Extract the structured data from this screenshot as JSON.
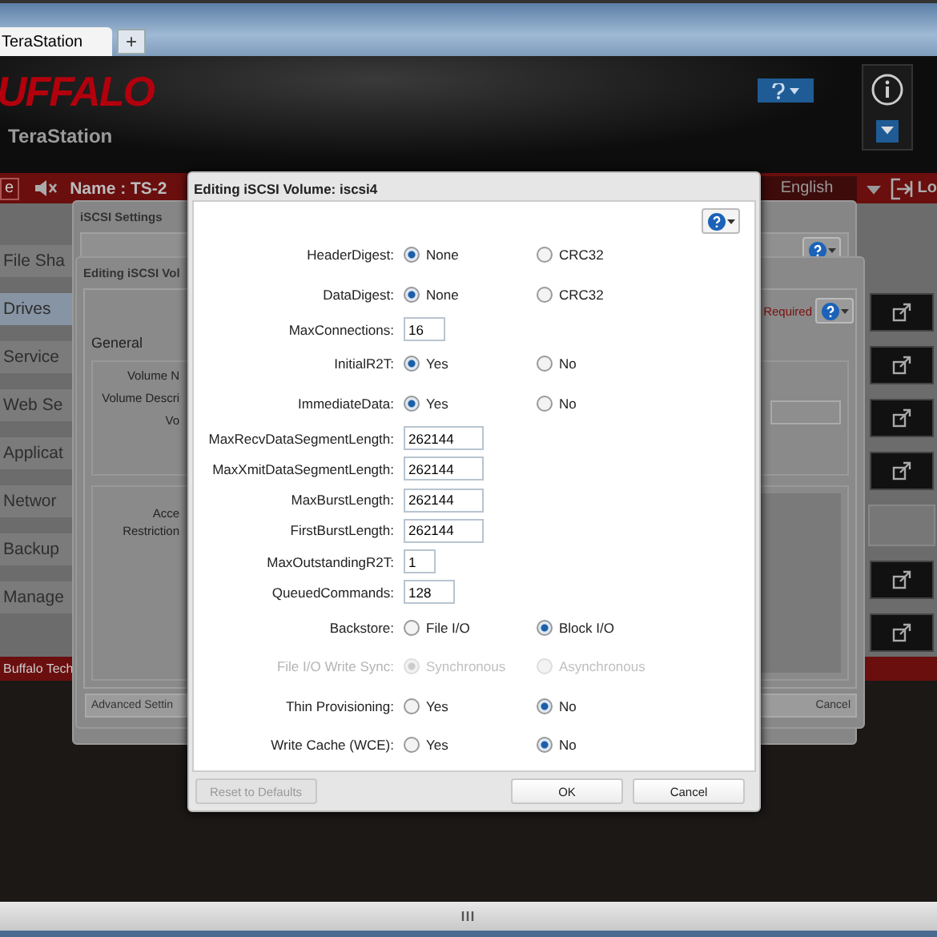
{
  "browser": {
    "tab": {
      "title": "TeraStation"
    },
    "new_tab_button": "+"
  },
  "header": {
    "logo": "UFFALO",
    "product": "TeraStation"
  },
  "top_bar": {
    "button_fragment": "e",
    "name": "Name : TS-2",
    "language": "English",
    "logout_fragment": "Lo"
  },
  "sidebar": {
    "items": [
      {
        "label": "File Sha",
        "selected": false
      },
      {
        "label": "Drives",
        "selected": true
      },
      {
        "label": "Service",
        "selected": false
      },
      {
        "label": "Web Se",
        "selected": false
      },
      {
        "label": "Applicat",
        "selected": false
      },
      {
        "label": "Networ",
        "selected": false
      },
      {
        "label": "Backup",
        "selected": false
      },
      {
        "label": "Manage",
        "selected": false
      }
    ]
  },
  "footer": {
    "text": "Buffalo Tech"
  },
  "settings_dialog": {
    "title": "iSCSI Settings"
  },
  "volume_dialog": {
    "title": "Editing iSCSI Vol",
    "required": "Required",
    "section": "General",
    "labels": [
      "Volume N",
      "Volume Descri",
      "Vo"
    ],
    "access_labels": [
      "Acce",
      "Restriction"
    ],
    "buttons": [
      "Advanced Settin",
      "Cancel"
    ]
  },
  "modal": {
    "title": "Editing iSCSI Volume: iscsi4",
    "rows": [
      {
        "kind": "radio",
        "label": "HeaderDigest:",
        "disabled": false,
        "options": [
          {
            "label": "None",
            "selected": true
          },
          {
            "label": "CRC32",
            "selected": false
          }
        ]
      },
      {
        "kind": "radio",
        "label": "DataDigest:",
        "disabled": false,
        "options": [
          {
            "label": "None",
            "selected": true
          },
          {
            "label": "CRC32",
            "selected": false
          }
        ]
      },
      {
        "kind": "input",
        "label": "MaxConnections:",
        "value": "16"
      },
      {
        "kind": "radio",
        "label": "InitialR2T:",
        "disabled": false,
        "options": [
          {
            "label": "Yes",
            "selected": true
          },
          {
            "label": "No",
            "selected": false
          }
        ]
      },
      {
        "kind": "radio",
        "label": "ImmediateData:",
        "disabled": false,
        "options": [
          {
            "label": "Yes",
            "selected": true
          },
          {
            "label": "No",
            "selected": false
          }
        ]
      },
      {
        "kind": "input",
        "label": "MaxRecvDataSegmentLength:",
        "value": "262144"
      },
      {
        "kind": "input",
        "label": "MaxXmitDataSegmentLength:",
        "value": "262144"
      },
      {
        "kind": "input",
        "label": "MaxBurstLength:",
        "value": "262144"
      },
      {
        "kind": "input",
        "label": "FirstBurstLength:",
        "value": "262144"
      },
      {
        "kind": "input",
        "label": "MaxOutstandingR2T:",
        "value": "1"
      },
      {
        "kind": "input",
        "label": "QueuedCommands:",
        "value": "128"
      },
      {
        "kind": "radio",
        "label": "Backstore:",
        "disabled": false,
        "options": [
          {
            "label": "File I/O",
            "selected": false
          },
          {
            "label": "Block I/O",
            "selected": true
          }
        ]
      },
      {
        "kind": "radio",
        "label": "File I/O Write Sync:",
        "disabled": true,
        "options": [
          {
            "label": "Synchronous",
            "selected": true
          },
          {
            "label": "Asynchronous",
            "selected": false
          }
        ]
      },
      {
        "kind": "radio",
        "label": "Thin Provisioning:",
        "disabled": false,
        "options": [
          {
            "label": "Yes",
            "selected": false
          },
          {
            "label": "No",
            "selected": true
          }
        ]
      },
      {
        "kind": "radio",
        "label": "Write Cache (WCE):",
        "disabled": false,
        "options": [
          {
            "label": "Yes",
            "selected": false
          },
          {
            "label": "No",
            "selected": true
          }
        ]
      }
    ],
    "buttons": [
      {
        "label": "Reset to Defaults",
        "disabled": true,
        "kind": "left"
      },
      {
        "label": "OK",
        "disabled": false,
        "kind": "right"
      },
      {
        "label": "Cancel",
        "disabled": false,
        "kind": "right"
      }
    ]
  }
}
